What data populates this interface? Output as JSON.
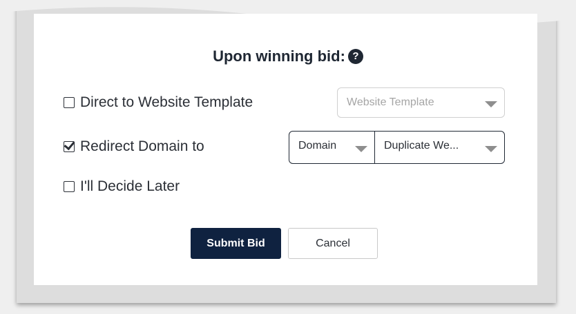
{
  "heading": {
    "text": "Upon winning bid:",
    "help_icon": "question-circle-icon"
  },
  "options": [
    {
      "label": "Direct to Website Template",
      "checked": false
    },
    {
      "label": "Redirect Domain to",
      "checked": true
    },
    {
      "label": "I'll Decide Later",
      "checked": false
    }
  ],
  "selects": {
    "website_template": {
      "placeholder": "Website Template"
    },
    "domain": {
      "value": "Domain"
    },
    "duplicate": {
      "value": "Duplicate We..."
    }
  },
  "buttons": {
    "submit": "Submit Bid",
    "cancel": "Cancel"
  },
  "colors": {
    "primary": "#0f2240",
    "text": "#1f2733",
    "placeholder": "#a5a5a5"
  }
}
